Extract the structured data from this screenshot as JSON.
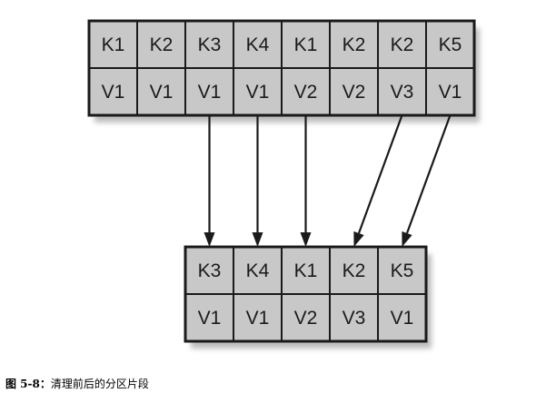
{
  "before": {
    "keys": [
      "K1",
      "K2",
      "K3",
      "K4",
      "K1",
      "K2",
      "K2",
      "K5"
    ],
    "values": [
      "V1",
      "V1",
      "V1",
      "V1",
      "V2",
      "V2",
      "V3",
      "V1"
    ]
  },
  "after": {
    "keys": [
      "K3",
      "K4",
      "K1",
      "K2",
      "K5"
    ],
    "values": [
      "V1",
      "V1",
      "V2",
      "V3",
      "V1"
    ]
  },
  "arrows": [
    {
      "from": 2,
      "to": 0
    },
    {
      "from": 3,
      "to": 1
    },
    {
      "from": 4,
      "to": 2
    },
    {
      "from": 6,
      "to": 3
    },
    {
      "from": 7,
      "to": 4
    }
  ],
  "caption": {
    "figure_number": "图 5-8：",
    "text": "清理前后的分区片段"
  },
  "colors": {
    "cell_fill": "#c8c8c8",
    "border": "#1a1a1a",
    "background": "#ffffff"
  }
}
